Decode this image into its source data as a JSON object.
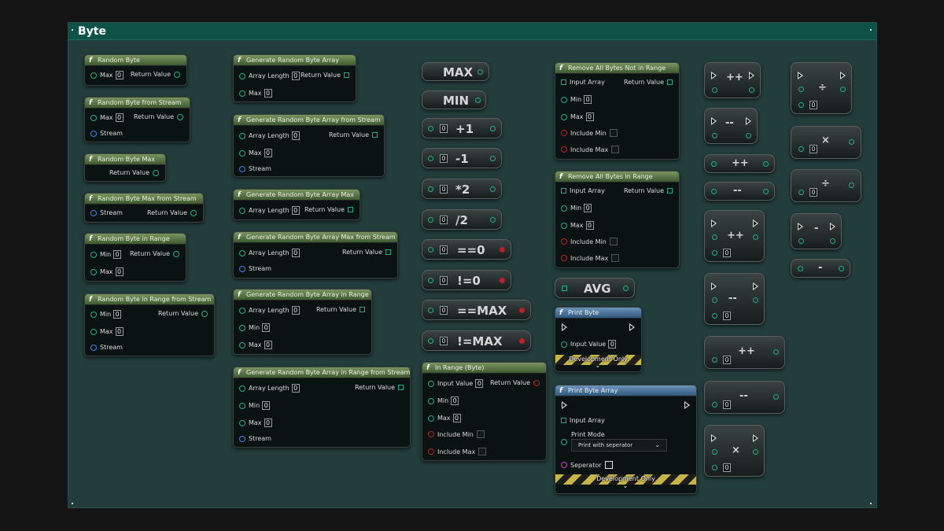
{
  "graph": {
    "title": "Byte"
  },
  "pins": {
    "max": "Max",
    "min": "Min",
    "stream": "Stream",
    "return_value": "Return Value",
    "array_length": "Array Length",
    "input_value": "Input Value",
    "input_array": "Input Array",
    "include_min": "Include Min",
    "include_max": "Include Max",
    "print_mode": "Print Mode",
    "seperator": "Seperator",
    "zero": "0"
  },
  "functions": {
    "random_byte": "Random Byte",
    "random_byte_from_stream": "Random Byte from Stream",
    "random_byte_max": "Random Byte Max",
    "random_byte_max_from_stream": "Random Byte Max from Stream",
    "random_byte_in_range": "Random Byte in Range",
    "random_byte_in_range_from_stream": "Random Byte in Range from Stream",
    "gen_array": "Generate Random Byte Array",
    "gen_array_from_stream": "Generate Random Byte Array from Stream",
    "gen_array_max": "Generate Random Byte Array Max",
    "gen_array_max_from_stream": "Generate Random Byte Array Max from Stream",
    "gen_array_in_range": "Generate Random Byte Array in Range",
    "gen_array_in_range_from_stream": "Generate Random Byte Array in Range from Stream",
    "remove_not_in_range": "Remove All Bytes Not in Range",
    "remove_in_range": "Remove All Bytes in Range",
    "in_range_byte": "In Range (Byte)",
    "print_byte": "Print Byte",
    "print_byte_array": "Print Byte Array"
  },
  "compact": {
    "max": "MAX",
    "min": "MIN",
    "plus1": "+1",
    "minus1": "-1",
    "times2": "*2",
    "div2": "/2",
    "eq0": "==0",
    "neq0": "!=0",
    "eqmax": "==MAX",
    "neqmax": "!=MAX",
    "avg": "AVG",
    "inc": "++",
    "dec": "--",
    "mul": "×",
    "div": "÷",
    "neg": "-",
    "sub": "-"
  },
  "print": {
    "development_only": "Development Only",
    "print_mode_value": "Print with seperator",
    "chevron": "⌄"
  }
}
